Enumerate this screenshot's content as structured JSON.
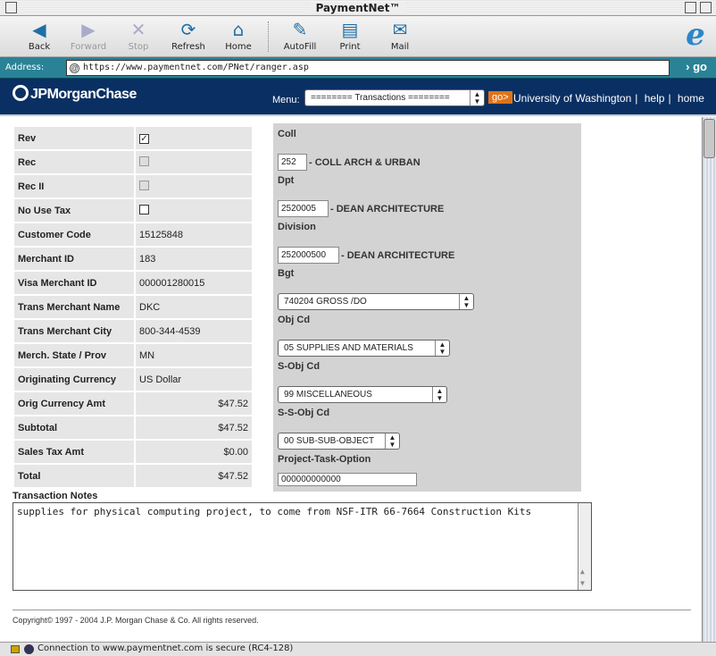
{
  "window": {
    "title": "PaymentNet™"
  },
  "toolbar": {
    "buttons": [
      {
        "label": "Back",
        "icon": "back-arrow-icon"
      },
      {
        "label": "Forward",
        "icon": "forward-arrow-icon"
      },
      {
        "label": "Stop",
        "icon": "stop-icon"
      },
      {
        "label": "Refresh",
        "icon": "refresh-icon"
      },
      {
        "label": "Home",
        "icon": "home-icon"
      },
      {
        "label": "AutoFill",
        "icon": "autofill-icon"
      },
      {
        "label": "Print",
        "icon": "print-icon"
      },
      {
        "label": "Mail",
        "icon": "mail-icon"
      }
    ]
  },
  "address": {
    "label": "Address:",
    "url": "https://www.paymentnet.com/PNet/ranger.asp",
    "go": "go"
  },
  "banner": {
    "logo": "JPMorganChase",
    "menu_label": "Menu:",
    "menu_value": "======== Transactions ========",
    "go": "go>",
    "org": "University of Washington",
    "help": "help",
    "home": "home",
    "sep": "|"
  },
  "left_fields": [
    {
      "label": "Rev",
      "value": "",
      "checkbox": "checked"
    },
    {
      "label": "Rec",
      "value": "",
      "checkbox": "disabled"
    },
    {
      "label": "Rec II",
      "value": "",
      "checkbox": "disabled"
    },
    {
      "label": "No Use Tax",
      "value": "",
      "checkbox": "unchecked"
    },
    {
      "label": "Customer Code",
      "value": "15125848"
    },
    {
      "label": "Merchant ID",
      "value": "183"
    },
    {
      "label": "Visa Merchant ID",
      "value": "000001280015"
    },
    {
      "label": "Trans Merchant Name",
      "value": "DKC"
    },
    {
      "label": "Trans Merchant City",
      "value": "800-344-4539"
    },
    {
      "label": "Merch. State / Prov",
      "value": "MN"
    },
    {
      "label": "Originating Currency",
      "value": "US Dollar"
    },
    {
      "label": "Orig Currency Amt",
      "value": "$47.52",
      "num": true
    },
    {
      "label": "Subtotal",
      "value": "$47.52",
      "num": true
    },
    {
      "label": "Sales Tax Amt",
      "value": "$0.00",
      "num": true
    },
    {
      "label": "Total",
      "value": "$47.52",
      "num": true
    }
  ],
  "right": {
    "coll": {
      "label": "Coll",
      "value": "252",
      "desc": "- COLL ARCH & URBAN"
    },
    "dpt": {
      "label": "Dpt",
      "value": "2520005",
      "desc": "- DEAN ARCHITECTURE"
    },
    "division": {
      "label": "Division",
      "value": "252000500",
      "desc": "- DEAN ARCHITECTURE"
    },
    "bgt": {
      "label": "Bgt",
      "value": "740204 GROSS /DO"
    },
    "obj": {
      "label": "Obj Cd",
      "value": "05 SUPPLIES AND MATERIALS"
    },
    "sobj": {
      "label": "S-Obj Cd",
      "value": "99 MISCELLANEOUS"
    },
    "ssobj": {
      "label": "S-S-Obj Cd",
      "value": "00 SUB-SUB-OBJECT"
    },
    "pto": {
      "label": "Project-Task-Option",
      "value": "000000000000"
    }
  },
  "notes": {
    "label": "Transaction Notes",
    "text": "supplies for physical computing project, to come from NSF-ITR 66-7664 Construction Kits"
  },
  "footer": {
    "copyright": "Copyright© 1997 - 2004 J.P. Morgan Chase & Co. All rights reserved."
  },
  "status": {
    "text": "Connection to www.paymentnet.com is secure (RC4-128)"
  }
}
